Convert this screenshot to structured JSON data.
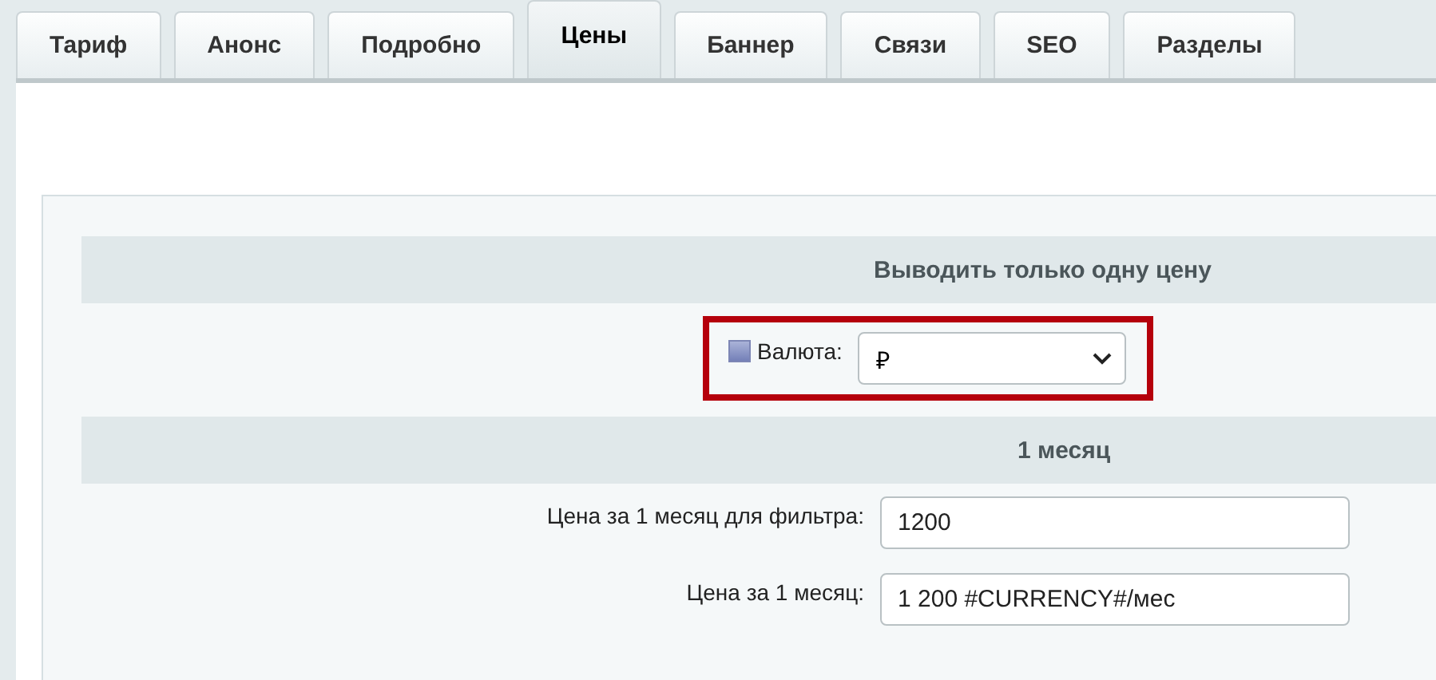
{
  "tabs": [
    {
      "label": "Тариф",
      "selected": false
    },
    {
      "label": "Анонс",
      "selected": false
    },
    {
      "label": "Подробно",
      "selected": false
    },
    {
      "label": "Цены",
      "selected": true
    },
    {
      "label": "Баннер",
      "selected": false
    },
    {
      "label": "Связи",
      "selected": false
    },
    {
      "label": "SEO",
      "selected": false
    },
    {
      "label": "Разделы",
      "selected": false
    }
  ],
  "sections": [
    {
      "title": "Выводить только одну цену",
      "fields": [
        {
          "kind": "select",
          "label": "Валюта:",
          "help": true,
          "value": "₽",
          "highlighted": true
        }
      ]
    },
    {
      "title": "1 месяц",
      "fields": [
        {
          "kind": "text",
          "label": "Цена за 1 месяц для фильтра:",
          "value": "1200",
          "highlighted": false
        },
        {
          "kind": "text",
          "label": "Цена за 1 месяц:",
          "value": "1 200 #CURRENCY#/мес",
          "highlighted": false
        }
      ]
    }
  ]
}
